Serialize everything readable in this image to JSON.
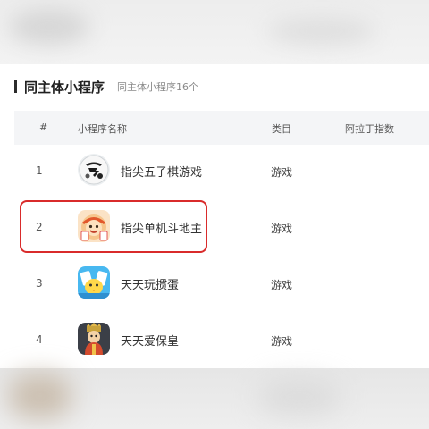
{
  "section": {
    "title": "同主体小程序",
    "subtitle": "同主体小程序16个"
  },
  "table": {
    "headers": {
      "index": "#",
      "name": "小程序名称",
      "category": "类目",
      "index_score": "阿拉丁指数"
    },
    "rows": [
      {
        "index": "1",
        "name": "指尖五子棋游戏",
        "category": "游戏",
        "icon": "gomoku-app-icon"
      },
      {
        "index": "2",
        "name": "指尖单机斗地主",
        "category": "游戏",
        "icon": "landlord-app-icon"
      },
      {
        "index": "3",
        "name": "天天玩掼蛋",
        "category": "游戏",
        "icon": "guandan-app-icon"
      },
      {
        "index": "4",
        "name": "天天爱保皇",
        "category": "游戏",
        "icon": "baohuang-app-icon"
      }
    ],
    "highlighted_row": 2
  },
  "colors": {
    "highlight_border": "#d92b2b",
    "header_bg": "#f4f5f7"
  }
}
